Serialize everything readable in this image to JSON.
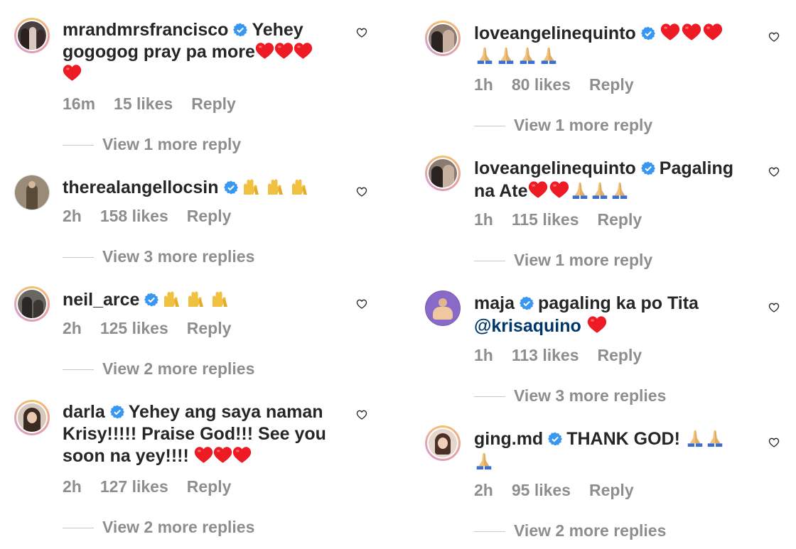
{
  "left": [
    {
      "username": "mrandmrsfrancisco",
      "text": "Yehey gogogog pray pa more",
      "time": "16m",
      "likes": "15 likes",
      "reply": "Reply",
      "view": "View 1 more reply",
      "photo": "#4a4040"
    },
    {
      "username": "therealangellocsin",
      "text": "",
      "time": "2h",
      "likes": "158 likes",
      "reply": "Reply",
      "view": "View 3 more replies",
      "photo": "#8a7a6a"
    },
    {
      "username": "neil_arce",
      "text": "",
      "time": "2h",
      "likes": "125 likes",
      "reply": "Reply",
      "view": "View 2 more replies",
      "photo": "#5a5650"
    },
    {
      "username": "darla",
      "text": "Yehey ang saya naman Krisy!!!!! Praise God!!! See you soon na yey!!!!",
      "time": "2h",
      "likes": "127 likes",
      "reply": "Reply",
      "view": "View 2 more replies",
      "photo": "#c9b8a8"
    }
  ],
  "right": [
    {
      "username": "loveangelinequinto",
      "text": "",
      "time": "1h",
      "likes": "80 likes",
      "reply": "Reply",
      "view": "View 1 more reply",
      "photo": "#6a5a50"
    },
    {
      "username": "loveangelinequinto",
      "text": "Pagaling na Ate",
      "time": "1h",
      "likes": "115 likes",
      "reply": "Reply",
      "view": "View 1 more reply",
      "photo": "#6a5a50"
    },
    {
      "username": "maja",
      "text": "pagaling ka po Tita",
      "mention": "@krisaquino",
      "time": "1h",
      "likes": "113 likes",
      "reply": "Reply",
      "view": "View 3 more replies",
      "photo": "#7a5ab0"
    },
    {
      "username": "ging.md",
      "text": "THANK GOD!",
      "time": "2h",
      "likes": "95 likes",
      "reply": "Reply",
      "view": "View 2 more replies",
      "photo": "#d8c0b0"
    }
  ],
  "icons": {
    "verified": "verified-badge-icon",
    "heart": "heart-outline-icon",
    "red_heart": "red-heart-emoji",
    "pray": "praying-hands-emoji",
    "raise": "raising-hands-emoji"
  },
  "colors": {
    "verified": "#3897f0",
    "heart": "#ed1c24",
    "muted": "#8e8e8e",
    "mention": "#00376b"
  }
}
